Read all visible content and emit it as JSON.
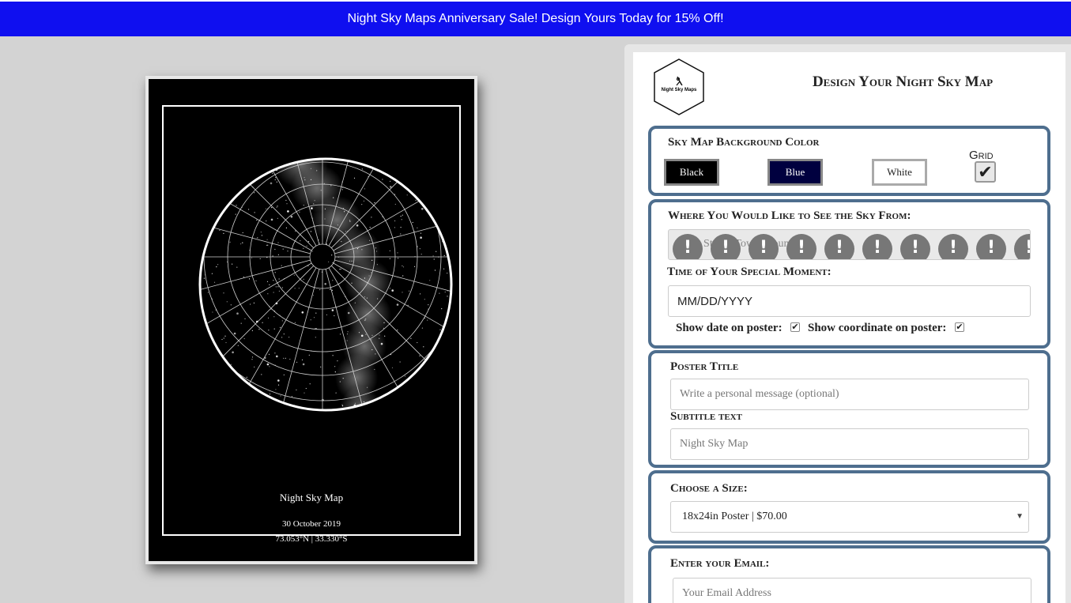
{
  "banner": {
    "text": "Night Sky Maps Anniversary Sale! Design Yours Today for 15% Off!"
  },
  "poster": {
    "title": "Night Sky Map",
    "date": "30 October 2019",
    "coordinates": "73.053°N | 33.330°S",
    "background": "#000000"
  },
  "panel": {
    "logo_text": "Night Sky Maps",
    "heading": "Design Your Night Sky Map",
    "background_color": {
      "label": "Sky Map Background Color",
      "options": [
        {
          "label": "Black",
          "color": "#000000",
          "text_color": "#ffffff"
        },
        {
          "label": "Blue",
          "color": "#00003f",
          "text_color": "#ffffff"
        },
        {
          "label": "White",
          "color": "#ffffff",
          "text_color": "#222222"
        }
      ],
      "grid_label": "Grid",
      "grid_checked": true
    },
    "location": {
      "label": "Where You Would Like to See the Sky From:",
      "placeholder": "E.g. Street, Town, Country..."
    },
    "moment": {
      "label": "Time of Your Special Moment:",
      "date_value": "MM/DD/YYYY",
      "show_date_label": "Show date on poster:",
      "show_date_checked": true,
      "show_coord_label": "Show coordinate on poster:",
      "show_coord_checked": true
    },
    "poster_title": {
      "label": "Poster Title",
      "placeholder": "Write a personal message (optional)",
      "subtitle_label": "Subtitle text",
      "subtitle_placeholder": "Night Sky Map"
    },
    "size": {
      "label": "Choose a Size:",
      "selected": "18x24in Poster | $70.00"
    },
    "email": {
      "label": "Enter your Email:",
      "placeholder": "Your Email Address"
    }
  },
  "colors": {
    "banner": "#0f0ff0",
    "section_border": "#4e6e8e"
  }
}
